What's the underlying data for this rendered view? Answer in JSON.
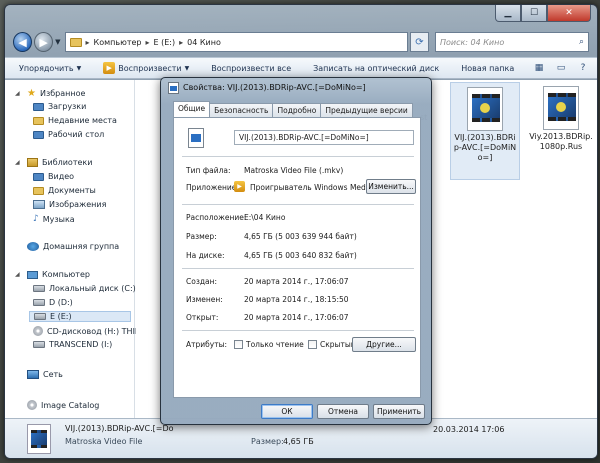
{
  "explorer": {
    "address": [
      "Компьютер",
      "E (E:)",
      "04 Кино"
    ],
    "search_placeholder": "Поиск: 04 Кино",
    "toolbar": {
      "organize": "Упорядочить",
      "play": "Воспроизвести",
      "play_all": "Воспроизвести все",
      "burn": "Записать на оптический диск",
      "new_folder": "Новая папка"
    },
    "sidebar": {
      "favorites": "Избранное",
      "downloads": "Загрузки",
      "recent": "Недавние места",
      "desktop": "Рабочий стол",
      "libraries": "Библиотеки",
      "video": "Видео",
      "documents": "Документы",
      "images": "Изображения",
      "music": "Музыка",
      "homegroup": "Домашняя группа",
      "computer": "Компьютер",
      "local_c": "Локальный диск (C:)",
      "drive_d": "D (D:)",
      "drive_e": "E (E:)",
      "cd_h": "CD-дисковод (H:) THIE",
      "transcend": "TRANSCEND (I:)",
      "network": "Сеть",
      "image_catalog": "Image Catalog"
    },
    "files": [
      {
        "name_partial": "st"
      },
      {
        "name": "VIJ.(2013).BDRip-AVC.[=DoMiNo=]"
      },
      {
        "name": "Viy.2013.BDRip.1080p.Rus"
      }
    ],
    "status": {
      "name": "VIJ.(2013).BDRip-AVC.[=Do",
      "type": "Matroska Video File",
      "size_label": "Размер:",
      "size_value": "4,65 ГБ",
      "date": "20.03.2014 17:06"
    }
  },
  "dialog": {
    "title": "Свойства: VIJ.(2013).BDRip-AVC.[=DoMiNo=]",
    "tabs": [
      "Общие",
      "Безопасность",
      "Подробно",
      "Предыдущие версии"
    ],
    "file_name": "VIJ.(2013).BDRip-AVC.[=DoMiNo=]",
    "file_type_label": "Тип файла:",
    "file_type_value": "Matroska Video File (.mkv)",
    "app_label": "Приложение:",
    "app_value": "Проигрыватель Windows Media",
    "change_button": "Изменить...",
    "location_label": "Расположение:",
    "location_value": "E:\\04 Кино",
    "size_label": "Размер:",
    "size_value": "4,65 ГБ (5 003 639 944 байт)",
    "ondisk_label": "На диске:",
    "ondisk_value": "4,65 ГБ (5 003 640 832 байт)",
    "created_label": "Создан:",
    "created_value": "20 марта 2014 г., 17:06:07",
    "modified_label": "Изменен:",
    "modified_value": "20 марта 2014 г., 18:15:50",
    "opened_label": "Открыт:",
    "opened_value": "20 марта 2014 г., 17:06:07",
    "attrs_label": "Атрибуты:",
    "readonly_label": "Только чтение",
    "hidden_label": "Скрытый",
    "other_button": "Другие...",
    "ok": "ОК",
    "cancel": "Отмена",
    "apply": "Применить"
  }
}
